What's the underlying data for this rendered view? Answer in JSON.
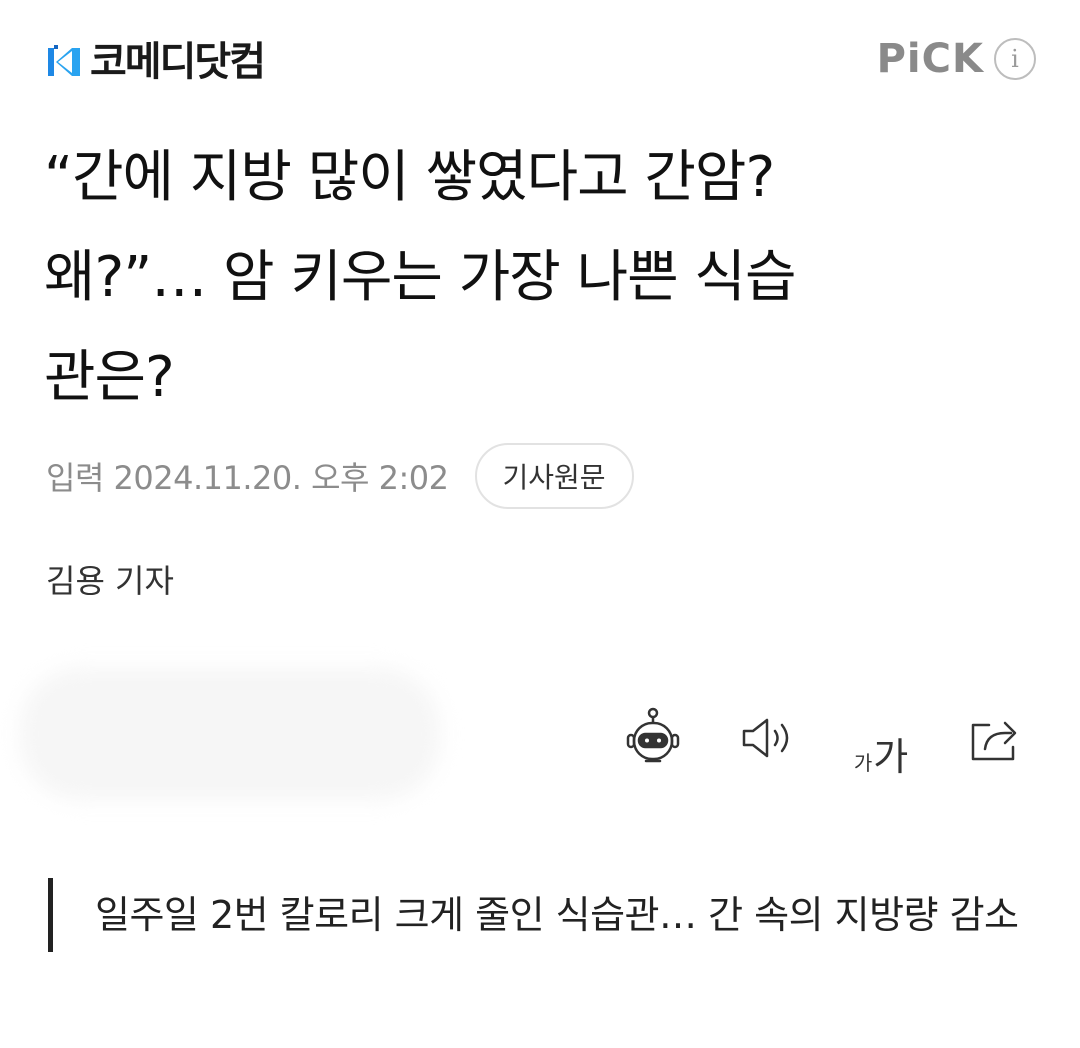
{
  "header": {
    "brand_name": "코메디닷컴",
    "brand_icon": "comedy-logo-icon",
    "pick_label": "PiCK",
    "info_glyph": "i"
  },
  "article": {
    "headline_lines": [
      "“간에 지방 많이 쌓였다고 간암?",
      "왜?”… 암 키우는 가장 나쁜 식습",
      "관은?"
    ],
    "date": "입력 2024.11.20. 오후 2:02",
    "original_button": "기사원문",
    "author": "김용 기자",
    "subtitle": "일주일 2번 칼로리 크게 줄인 식습관… 간 속의 지방량 감소"
  },
  "toolbar": {
    "robot_icon": "robot-summary-icon",
    "speaker_icon": "speaker-icon",
    "font_small": "가",
    "font_big": "가",
    "share_icon": "share-icon"
  },
  "colors": {
    "brand_blue": "#1e88e5",
    "pick_gray": "#8a8a8a",
    "meta_gray": "#8c8c8c"
  }
}
